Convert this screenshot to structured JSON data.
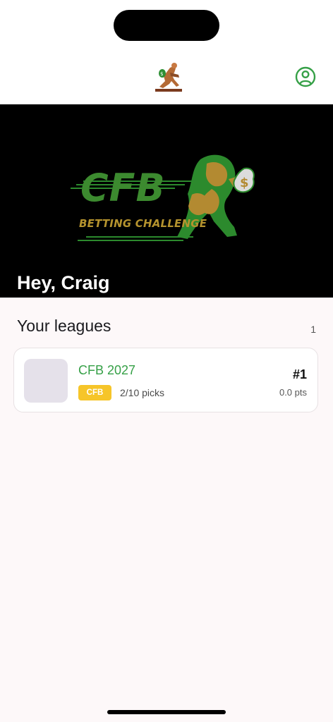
{
  "hero": {
    "greeting": "Hey, Craig",
    "logo_text": "CFB",
    "logo_subtitle": "BETTING CHALLENGE",
    "logo_currency_symbol": "$"
  },
  "leagues_section": {
    "title": "Your leagues",
    "count": "1"
  },
  "leagues": [
    {
      "name": "CFB 2027",
      "tag": "CFB",
      "picks": "2/10 picks",
      "rank": "#1",
      "points": "0.0 pts"
    }
  ],
  "icons": {
    "top_logo": "football-player-trophy-icon",
    "profile": "user-circle-icon",
    "hero_logo": "cfb-betting-challenge-logo"
  },
  "colors": {
    "accent_green": "#36a047",
    "tag_yellow": "#f6c529",
    "hero_gold": "#b5932e",
    "hero_bg": "#000000"
  }
}
